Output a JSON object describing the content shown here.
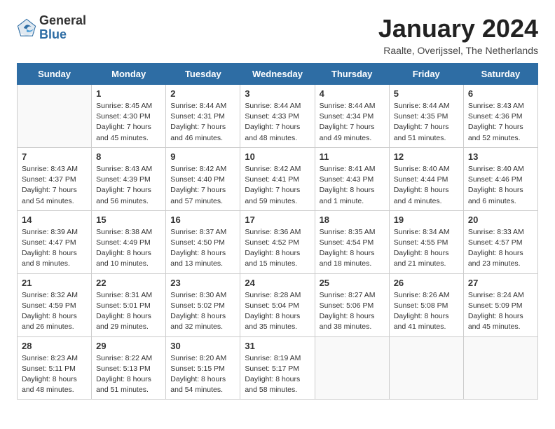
{
  "header": {
    "logo_general": "General",
    "logo_blue": "Blue",
    "month_title": "January 2024",
    "location": "Raalte, Overijssel, The Netherlands"
  },
  "days_of_week": [
    "Sunday",
    "Monday",
    "Tuesday",
    "Wednesday",
    "Thursday",
    "Friday",
    "Saturday"
  ],
  "weeks": [
    [
      {
        "day": "",
        "info": ""
      },
      {
        "day": "1",
        "info": "Sunrise: 8:45 AM\nSunset: 4:30 PM\nDaylight: 7 hours\nand 45 minutes."
      },
      {
        "day": "2",
        "info": "Sunrise: 8:44 AM\nSunset: 4:31 PM\nDaylight: 7 hours\nand 46 minutes."
      },
      {
        "day": "3",
        "info": "Sunrise: 8:44 AM\nSunset: 4:33 PM\nDaylight: 7 hours\nand 48 minutes."
      },
      {
        "day": "4",
        "info": "Sunrise: 8:44 AM\nSunset: 4:34 PM\nDaylight: 7 hours\nand 49 minutes."
      },
      {
        "day": "5",
        "info": "Sunrise: 8:44 AM\nSunset: 4:35 PM\nDaylight: 7 hours\nand 51 minutes."
      },
      {
        "day": "6",
        "info": "Sunrise: 8:43 AM\nSunset: 4:36 PM\nDaylight: 7 hours\nand 52 minutes."
      }
    ],
    [
      {
        "day": "7",
        "info": "Sunrise: 8:43 AM\nSunset: 4:37 PM\nDaylight: 7 hours\nand 54 minutes."
      },
      {
        "day": "8",
        "info": "Sunrise: 8:43 AM\nSunset: 4:39 PM\nDaylight: 7 hours\nand 56 minutes."
      },
      {
        "day": "9",
        "info": "Sunrise: 8:42 AM\nSunset: 4:40 PM\nDaylight: 7 hours\nand 57 minutes."
      },
      {
        "day": "10",
        "info": "Sunrise: 8:42 AM\nSunset: 4:41 PM\nDaylight: 7 hours\nand 59 minutes."
      },
      {
        "day": "11",
        "info": "Sunrise: 8:41 AM\nSunset: 4:43 PM\nDaylight: 8 hours\nand 1 minute."
      },
      {
        "day": "12",
        "info": "Sunrise: 8:40 AM\nSunset: 4:44 PM\nDaylight: 8 hours\nand 4 minutes."
      },
      {
        "day": "13",
        "info": "Sunrise: 8:40 AM\nSunset: 4:46 PM\nDaylight: 8 hours\nand 6 minutes."
      }
    ],
    [
      {
        "day": "14",
        "info": "Sunrise: 8:39 AM\nSunset: 4:47 PM\nDaylight: 8 hours\nand 8 minutes."
      },
      {
        "day": "15",
        "info": "Sunrise: 8:38 AM\nSunset: 4:49 PM\nDaylight: 8 hours\nand 10 minutes."
      },
      {
        "day": "16",
        "info": "Sunrise: 8:37 AM\nSunset: 4:50 PM\nDaylight: 8 hours\nand 13 minutes."
      },
      {
        "day": "17",
        "info": "Sunrise: 8:36 AM\nSunset: 4:52 PM\nDaylight: 8 hours\nand 15 minutes."
      },
      {
        "day": "18",
        "info": "Sunrise: 8:35 AM\nSunset: 4:54 PM\nDaylight: 8 hours\nand 18 minutes."
      },
      {
        "day": "19",
        "info": "Sunrise: 8:34 AM\nSunset: 4:55 PM\nDaylight: 8 hours\nand 21 minutes."
      },
      {
        "day": "20",
        "info": "Sunrise: 8:33 AM\nSunset: 4:57 PM\nDaylight: 8 hours\nand 23 minutes."
      }
    ],
    [
      {
        "day": "21",
        "info": "Sunrise: 8:32 AM\nSunset: 4:59 PM\nDaylight: 8 hours\nand 26 minutes."
      },
      {
        "day": "22",
        "info": "Sunrise: 8:31 AM\nSunset: 5:01 PM\nDaylight: 8 hours\nand 29 minutes."
      },
      {
        "day": "23",
        "info": "Sunrise: 8:30 AM\nSunset: 5:02 PM\nDaylight: 8 hours\nand 32 minutes."
      },
      {
        "day": "24",
        "info": "Sunrise: 8:28 AM\nSunset: 5:04 PM\nDaylight: 8 hours\nand 35 minutes."
      },
      {
        "day": "25",
        "info": "Sunrise: 8:27 AM\nSunset: 5:06 PM\nDaylight: 8 hours\nand 38 minutes."
      },
      {
        "day": "26",
        "info": "Sunrise: 8:26 AM\nSunset: 5:08 PM\nDaylight: 8 hours\nand 41 minutes."
      },
      {
        "day": "27",
        "info": "Sunrise: 8:24 AM\nSunset: 5:09 PM\nDaylight: 8 hours\nand 45 minutes."
      }
    ],
    [
      {
        "day": "28",
        "info": "Sunrise: 8:23 AM\nSunset: 5:11 PM\nDaylight: 8 hours\nand 48 minutes."
      },
      {
        "day": "29",
        "info": "Sunrise: 8:22 AM\nSunset: 5:13 PM\nDaylight: 8 hours\nand 51 minutes."
      },
      {
        "day": "30",
        "info": "Sunrise: 8:20 AM\nSunset: 5:15 PM\nDaylight: 8 hours\nand 54 minutes."
      },
      {
        "day": "31",
        "info": "Sunrise: 8:19 AM\nSunset: 5:17 PM\nDaylight: 8 hours\nand 58 minutes."
      },
      {
        "day": "",
        "info": ""
      },
      {
        "day": "",
        "info": ""
      },
      {
        "day": "",
        "info": ""
      }
    ]
  ]
}
